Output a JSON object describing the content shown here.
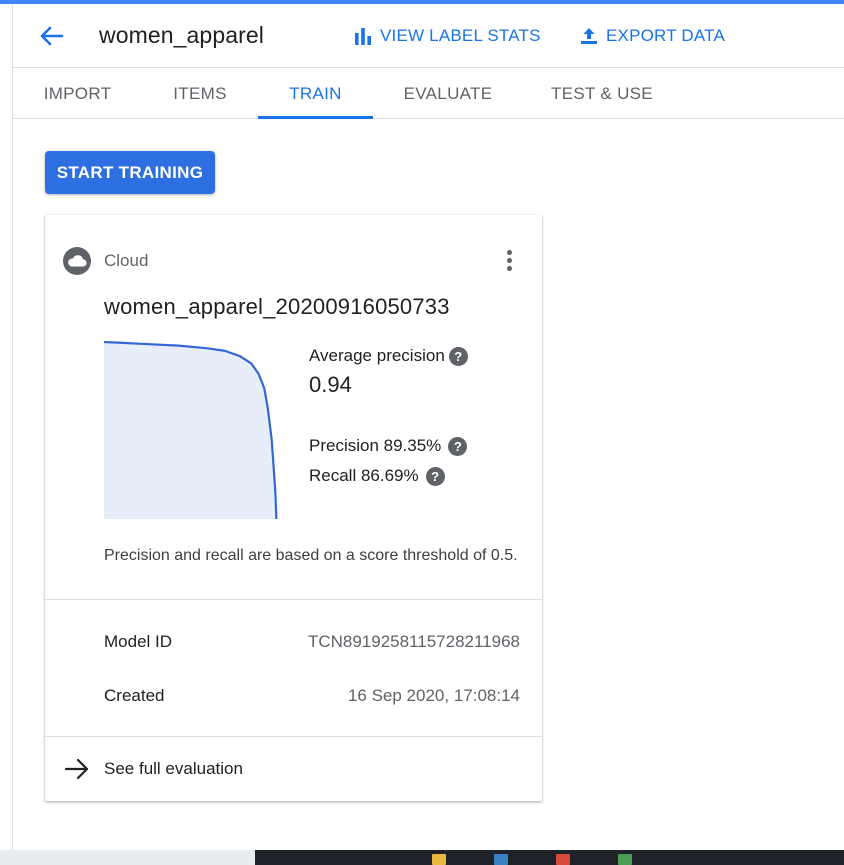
{
  "header": {
    "dataset_title": "women_apparel",
    "view_label_stats": "VIEW LABEL STATS",
    "export_data": "EXPORT DATA"
  },
  "tabs": [
    {
      "label": "IMPORT",
      "active": false
    },
    {
      "label": "ITEMS",
      "active": false
    },
    {
      "label": "TRAIN",
      "active": true
    },
    {
      "label": "EVALUATE",
      "active": false
    },
    {
      "label": "TEST & USE",
      "active": false
    }
  ],
  "start_training_label": "START TRAINING",
  "model_card": {
    "environment": "Cloud",
    "model_name": "women_apparel_20200916050733",
    "average_precision_label": "Average precision",
    "average_precision_value": "0.94",
    "precision_text": "Precision 89.35%",
    "recall_text": "Recall 86.69%",
    "threshold_note": "Precision and recall are based on a score threshold of 0.5.",
    "model_id_label": "Model ID",
    "model_id_value": "TCN8919258115728211968",
    "created_label": "Created",
    "created_value": "16 Sep 2020, 17:08:14",
    "see_full_evaluation": "See full evaluation",
    "help_glyph": "?"
  },
  "pr_curve": {
    "points": [
      [
        0.0,
        1.0
      ],
      [
        0.2,
        0.99
      ],
      [
        0.4,
        0.98
      ],
      [
        0.55,
        0.965
      ],
      [
        0.65,
        0.95
      ],
      [
        0.73,
        0.92
      ],
      [
        0.79,
        0.88
      ],
      [
        0.83,
        0.82
      ],
      [
        0.86,
        0.74
      ],
      [
        0.88,
        0.62
      ],
      [
        0.9,
        0.45
      ],
      [
        0.91,
        0.3
      ],
      [
        0.92,
        0.15
      ],
      [
        0.925,
        0.0
      ]
    ]
  },
  "colors": {
    "accent": "#1a73e8",
    "button": "#2d6fe0",
    "curve_line": "#3367d6",
    "curve_fill": "#e8eef9"
  },
  "icons": {
    "back": "arrow-back-icon",
    "stats": "bar-chart-icon",
    "export": "upload-icon",
    "environment": "cloud-icon",
    "menu": "more-vert-icon",
    "help": "help-icon",
    "forward": "arrow-forward-icon"
  }
}
